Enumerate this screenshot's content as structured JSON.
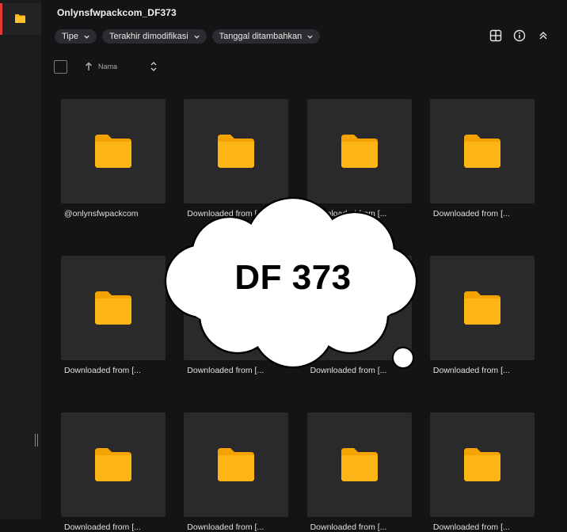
{
  "window": {
    "title": "Onlynsfwpackcom_DF373"
  },
  "filters": [
    {
      "label": "Tipe"
    },
    {
      "label": "Terakhir dimodifikasi"
    },
    {
      "label": "Tanggal ditambahkan"
    }
  ],
  "toolbar": {
    "icons": [
      "grid-view-icon",
      "info-icon",
      "collapse-icon"
    ]
  },
  "sort": {
    "label": "Nama",
    "direction": "ascending"
  },
  "colors": {
    "folder": "#FDB515",
    "folder_dark": "#F5A300",
    "accent": "#e53935",
    "tile_bg": "#2a2a2d"
  },
  "items": [
    {
      "name": "@onlynsfwpackcom"
    },
    {
      "name": "Downloaded from [..."
    },
    {
      "name": "Downloaded from [..."
    },
    {
      "name": "Downloaded from [..."
    },
    {
      "name": "Downloaded from [..."
    },
    {
      "name": "Downloaded from [..."
    },
    {
      "name": "Downloaded from [..."
    },
    {
      "name": "Downloaded from [..."
    },
    {
      "name": "Downloaded from [..."
    },
    {
      "name": "Downloaded from [..."
    },
    {
      "name": "Downloaded from [..."
    },
    {
      "name": "Downloaded from [..."
    }
  ],
  "overlay": {
    "text": "DF 373"
  }
}
